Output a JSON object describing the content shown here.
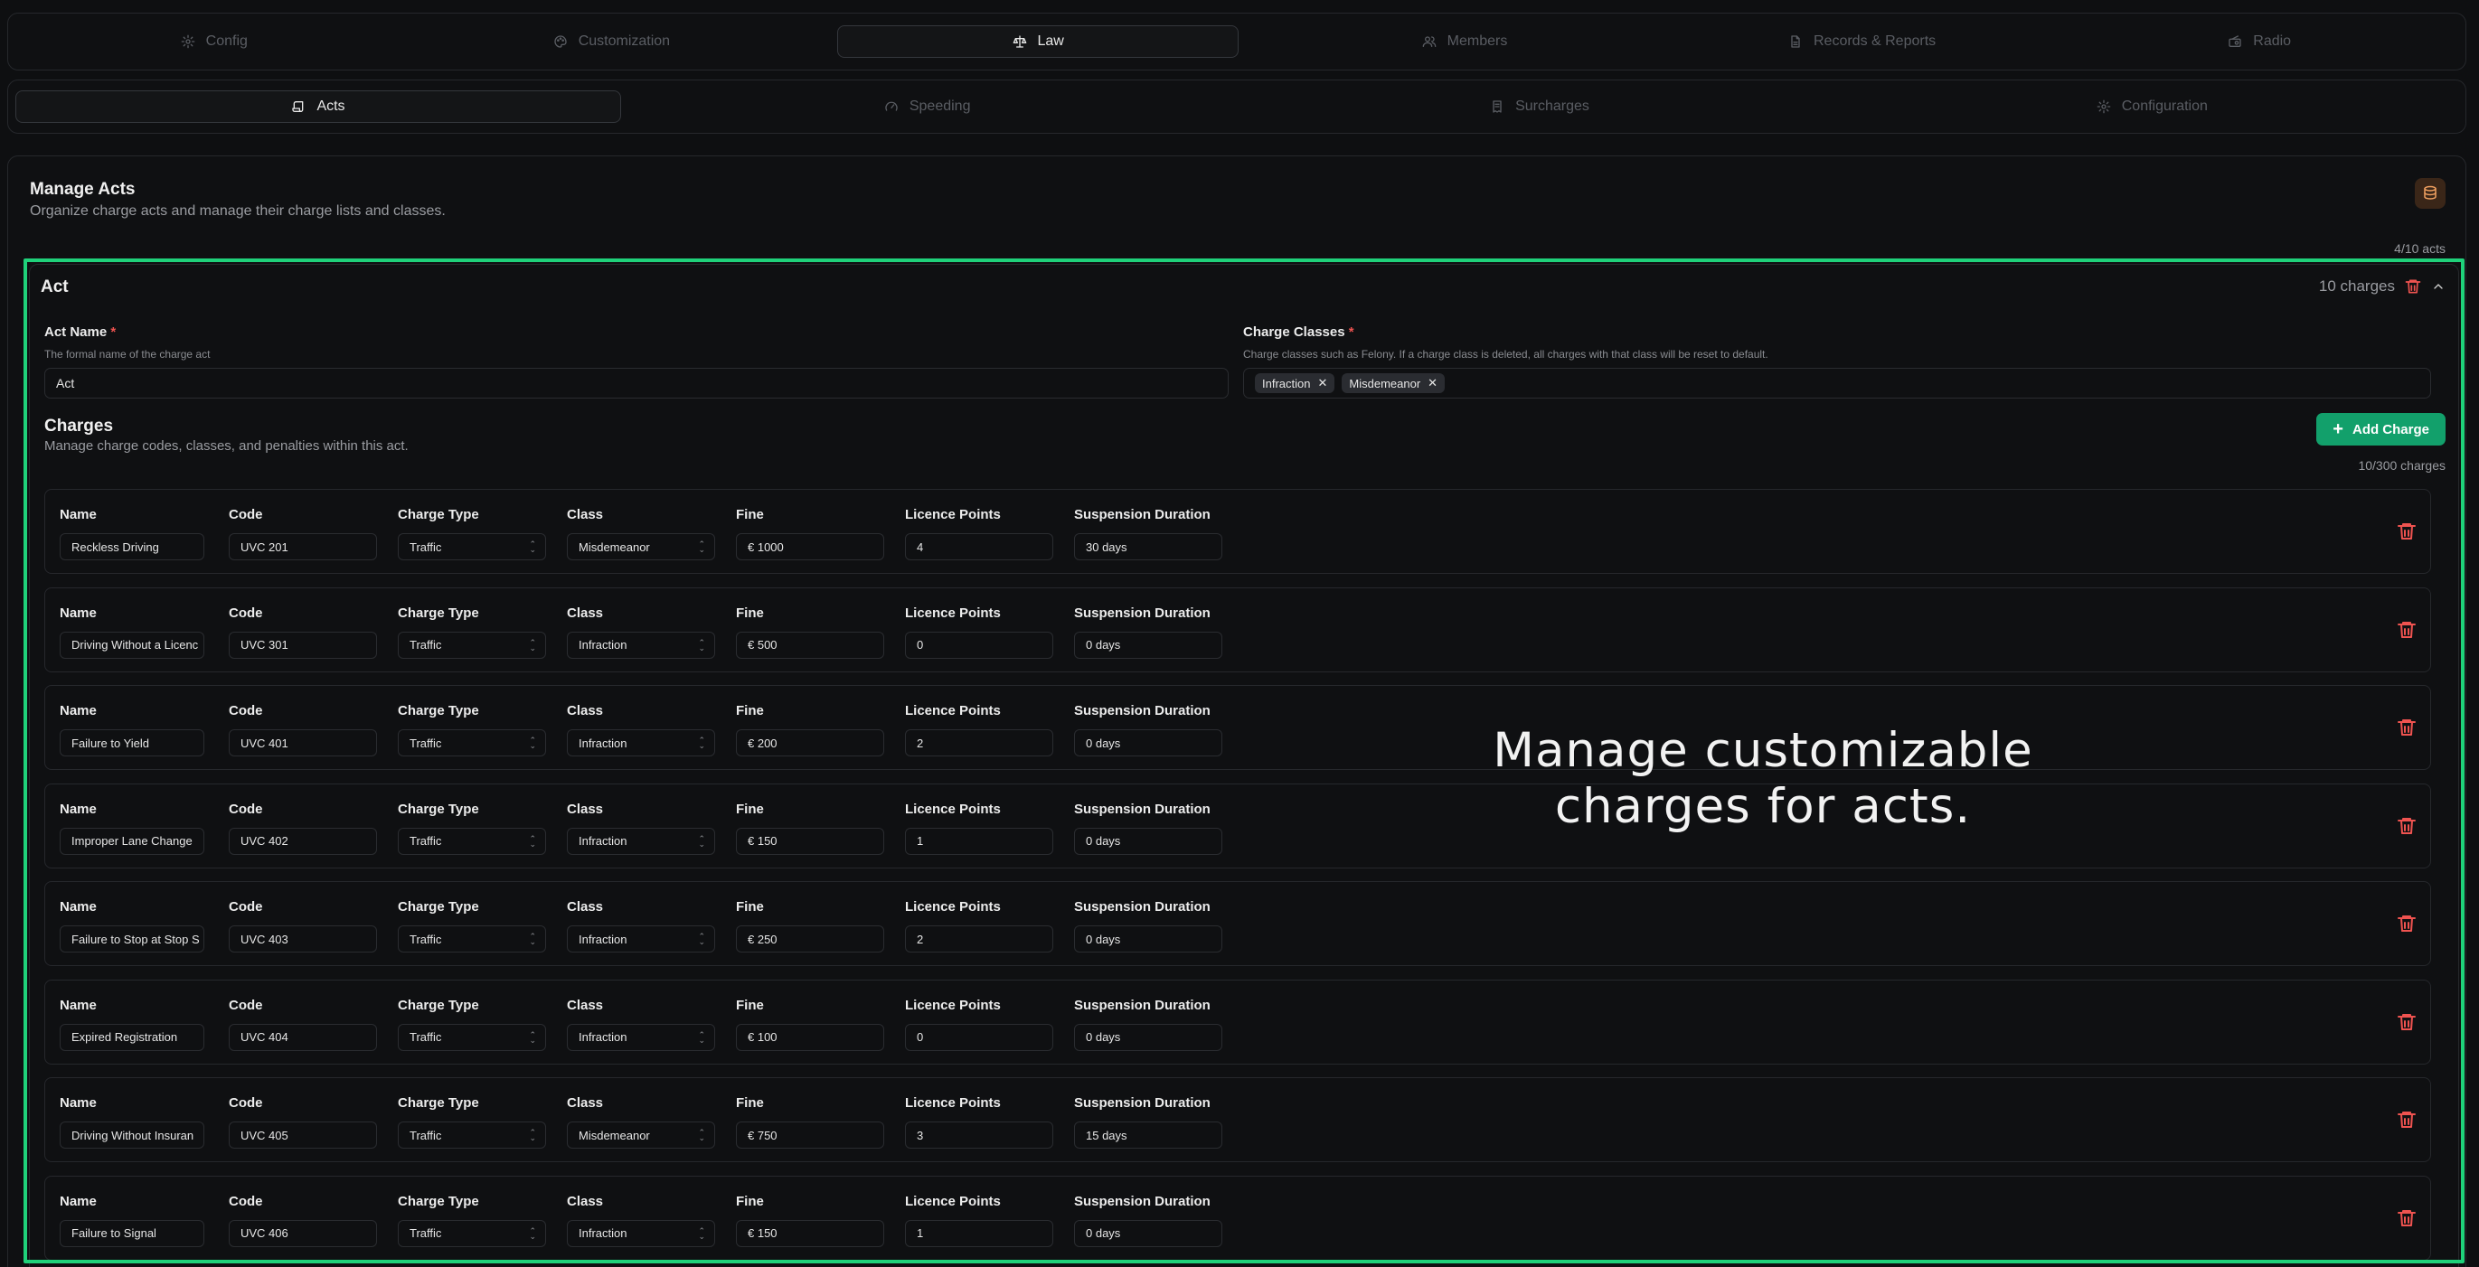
{
  "top_tabs": [
    {
      "label": "Config",
      "icon": "gear-icon",
      "active": false
    },
    {
      "label": "Customization",
      "icon": "palette-icon",
      "active": false
    },
    {
      "label": "Law",
      "icon": "scale-icon",
      "active": true
    },
    {
      "label": "Members",
      "icon": "users-icon",
      "active": false
    },
    {
      "label": "Records & Reports",
      "icon": "file-icon",
      "active": false
    },
    {
      "label": "Radio",
      "icon": "radio-icon",
      "active": false
    }
  ],
  "sub_tabs": [
    {
      "label": "Acts",
      "icon": "scroll-icon",
      "active": true
    },
    {
      "label": "Speeding",
      "icon": "gauge-icon",
      "active": false
    },
    {
      "label": "Surcharges",
      "icon": "receipt-icon",
      "active": false
    },
    {
      "label": "Configuration",
      "icon": "gear-icon",
      "active": false
    }
  ],
  "manage": {
    "title": "Manage Acts",
    "subtitle": "Organize charge acts and manage their charge lists and classes.",
    "acts_count": "4/10 acts"
  },
  "act": {
    "title": "Act",
    "charges_count": "10 charges",
    "name_label": "Act Name",
    "required_mark": "*",
    "name_help": "The formal name of the charge act",
    "name_value": "Act",
    "classes_label": "Charge Classes",
    "classes_help": "Charge classes such as Felony. If a charge class is deleted, all charges with that class will be reset to default.",
    "classes": [
      "Infraction",
      "Misdemeanor"
    ],
    "remove_glyph": "✕"
  },
  "charges": {
    "title": "Charges",
    "subtitle": "Manage charge codes, classes, and penalties within this act.",
    "add_label": "Add Charge",
    "count": "10/300 charges",
    "columns": [
      "Name",
      "Code",
      "Charge Type",
      "Class",
      "Fine",
      "Licence Points",
      "Suspension Duration"
    ],
    "rows": [
      {
        "name": "Reckless Driving",
        "code": "UVC 201",
        "type": "Traffic",
        "class": "Misdemeanor",
        "fine": "€ 1000",
        "points": "4",
        "suspension": "30 days"
      },
      {
        "name": "Driving Without a Licenc",
        "code": "UVC 301",
        "type": "Traffic",
        "class": "Infraction",
        "fine": "€ 500",
        "points": "0",
        "suspension": "0 days"
      },
      {
        "name": "Failure to Yield",
        "code": "UVC 401",
        "type": "Traffic",
        "class": "Infraction",
        "fine": "€ 200",
        "points": "2",
        "suspension": "0 days"
      },
      {
        "name": "Improper Lane Change",
        "code": "UVC 402",
        "type": "Traffic",
        "class": "Infraction",
        "fine": "€ 150",
        "points": "1",
        "suspension": "0 days"
      },
      {
        "name": "Failure to Stop at Stop S",
        "code": "UVC 403",
        "type": "Traffic",
        "class": "Infraction",
        "fine": "€ 250",
        "points": "2",
        "suspension": "0 days"
      },
      {
        "name": "Expired Registration",
        "code": "UVC 404",
        "type": "Traffic",
        "class": "Infraction",
        "fine": "€ 100",
        "points": "0",
        "suspension": "0 days"
      },
      {
        "name": "Driving Without Insuran",
        "code": "UVC 405",
        "type": "Traffic",
        "class": "Misdemeanor",
        "fine": "€ 750",
        "points": "3",
        "suspension": "15 days"
      },
      {
        "name": "Failure to Signal",
        "code": "UVC 406",
        "type": "Traffic",
        "class": "Infraction",
        "fine": "€ 150",
        "points": "1",
        "suspension": "0 days"
      }
    ]
  },
  "caption": "Manage customizable charges for acts.",
  "colors": {
    "accent_green": "#12a06b",
    "highlight_green": "#1fd17a",
    "danger_red": "#ef5350",
    "background": "#0e0f11"
  }
}
